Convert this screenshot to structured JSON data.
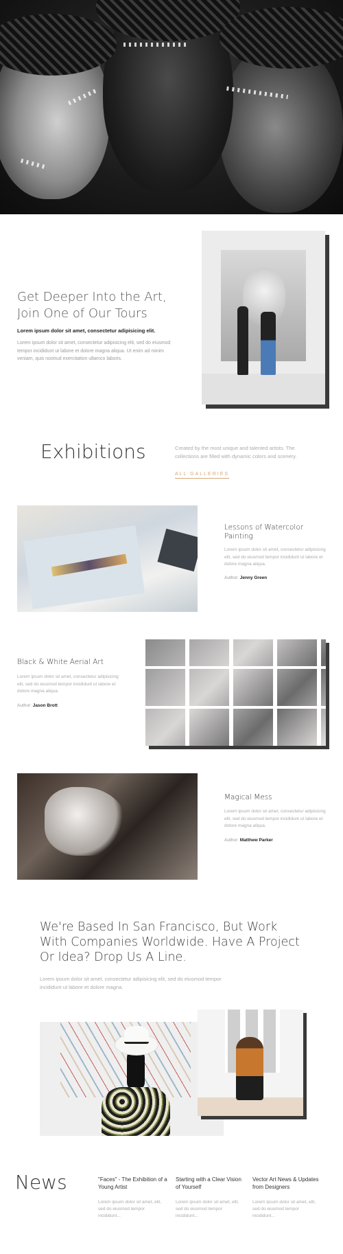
{
  "hero": {
    "alt_icon": "portrait-photo"
  },
  "tours": {
    "title_line1": "Get Deeper Into the Art,",
    "title_line2": "Join One of Our Tours",
    "lead": "Lorem ipsum dolor sit amet, consectetur adipisicing elit.",
    "body": "Lorem ipsum dolor sit amet, consectetur adipisicing elit, sed do eiusmod tempor incididunt ut labore et dolore magna aliqua. Ut enim ad minim veniam, quis nostrud exercitation ullamco laboris."
  },
  "exhibitions": {
    "title": "Exhibitions",
    "description": "Created by the most unique and talented artists. The collections are filled with dynamic colors and scenery.",
    "link_label": "ALL GALLERIES",
    "accent_color": "#d6a77a",
    "items": [
      {
        "title": "Lessons of Watercolor Painting",
        "body": "Lorem ipsum dolor sit amet, consectetur adipisicing elit, sed do eiusmod tempor incididunt ut labore et dolore magna aliqua.",
        "author_label": "Author:",
        "author": "Jenny Green"
      },
      {
        "title": "Black & White Aerial Art",
        "body": "Lorem ipsum dolor sit amet, consectetur adipisicing elit, sed do eiusmod tempor incididunt ut labore et dolore magna aliqua.",
        "author_label": "Author:",
        "author": "Jason Brott"
      },
      {
        "title": "Magical Mess",
        "body": "Lorem ipsum dolor sit amet, consectetur adipisicing elit, sed do eiusmod tempor incididunt ut labore et dolore magna aliqua.",
        "author_label": "Author:",
        "author": "Matthew Parker"
      }
    ]
  },
  "contact": {
    "title": "We're Based In San Francisco, But Work With Companies Worldwide. Have A Project Or Idea? Drop Us A Line.",
    "body": "Lorem ipsum dolor sit amet, consectetur adipisicing elit, sed do eiusmod tempor incididunt ut labore et dolore magna."
  },
  "news": {
    "title": "News",
    "items": [
      {
        "title": "\"Faces\" - The Exhibition of a Young Artist",
        "body": "Lorem ipsum dolor sit amet, elit, sed do eiusmod tempor incididunt..."
      },
      {
        "title": "Starting with a Clear Vision of Yourself",
        "body": "Lorem ipsum dolor sit amet, elit, sed do eiusmod tempor incididunt..."
      },
      {
        "title": "Vector Art News & Updates from Designers",
        "body": "Lorem ipsum dolor sit amet, elit, sed do eiusmod tempor incididunt..."
      }
    ]
  }
}
